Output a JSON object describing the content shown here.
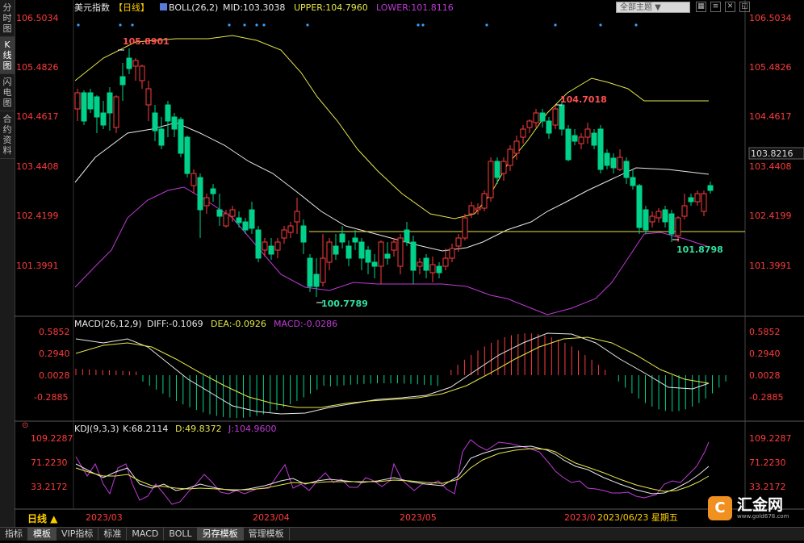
{
  "left_tabs": [
    "分时图",
    "K线图",
    "闪电图",
    "合约资料"
  ],
  "active_left_tab": 1,
  "header": {
    "symbol": "美元指数",
    "period_bracket": "【日线】",
    "indicator_name": "BOLL(26,2)",
    "mid": "MID:103.3038",
    "upper": "UPPER:104.7960",
    "lower": "LOWER:101.8116"
  },
  "theme_dropdown": "全部主题 ▼",
  "toolbar_icons": [
    "grid-icon",
    "list-icon",
    "close-icon",
    "restore-icon"
  ],
  "price_axis": [
    "106.5034",
    "105.4826",
    "104.4617",
    "103.4408",
    "102.4199",
    "101.3991"
  ],
  "current_price": "103.8216",
  "annotations": {
    "high1": "105.8901",
    "low1": "100.7789",
    "high2": "104.7018",
    "low2": "101.8798"
  },
  "macd": {
    "title": "MACD(26,12,9)",
    "diff": "DIFF:-0.1069",
    "dea": "DEA:-0.0926",
    "macd": "MACD:-0.0286",
    "axis": [
      "0.5852",
      "0.2940",
      "0.0028",
      "-0.2885"
    ]
  },
  "kdj": {
    "title": "KDJ(9,3,3)",
    "k": "K:68.2114",
    "d": "D:49.8372",
    "j": "J:104.9600",
    "axis": [
      "109.2287",
      "71.2230",
      "33.2172"
    ]
  },
  "date_axis": [
    "2023/03",
    "2023/04",
    "2023/05",
    "2023/0"
  ],
  "cursor_date": "2023/06/23 星期五",
  "period_selector": "日线 ▲",
  "bottom_toolbar": [
    "指标",
    "模板",
    "VIP指标",
    "标准",
    "MACD",
    "BOLL",
    "另存模板",
    "管理模板"
  ],
  "active_bottom": [
    1,
    6
  ],
  "watermark": {
    "name": "汇金网",
    "url": "www.gold678.com"
  },
  "colors": {
    "up": "#ff3b3b",
    "down": "#00d28c",
    "upper": "#e6e64a",
    "lower": "#c03ad8",
    "mid": "#e8e8e8"
  }
}
